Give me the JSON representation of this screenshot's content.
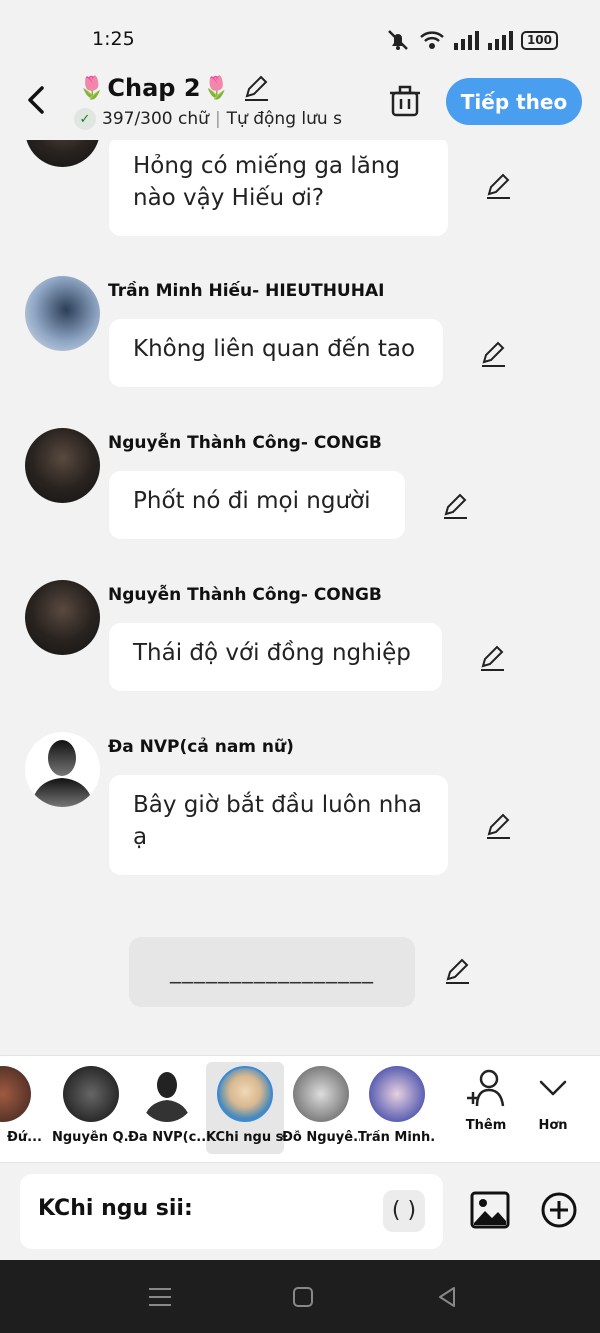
{
  "status": {
    "time": "1:25",
    "battery": "100"
  },
  "header": {
    "title": "Chap 2",
    "word_count": "397/300 chữ",
    "autosave": "Tự động lưu s",
    "next_button": "Tiếp theo"
  },
  "messages": [
    {
      "sender": "",
      "text": "Hỏng có miếng ga lăng nào vậy Hiếu ơi?"
    },
    {
      "sender": "Trần Minh Hiếu- HIEUTHUHAI",
      "text": "Không liên quan đến tao"
    },
    {
      "sender": "Nguyễn Thành Công- CONGB",
      "text": "Phốt nó đi mọi người"
    },
    {
      "sender": "Nguyễn Thành Công- CONGB",
      "text": "Thái độ với đồng nghiệp"
    },
    {
      "sender": "Đa NVP(cả nam nữ)",
      "text": "Bây giờ bắt đầu luôn nha ạ"
    }
  ],
  "empty_message": "_________________",
  "characters": [
    {
      "name": "Đứ..."
    },
    {
      "name": "Nguyễn Q..."
    },
    {
      "name": "Đa NVP(c..."
    },
    {
      "name": "KChi ngu sii"
    },
    {
      "name": "Đỗ Nguyê..."
    },
    {
      "name": "Trần Minh..."
    }
  ],
  "utilities": {
    "add": "Thêm",
    "more": "Hơn"
  },
  "input": {
    "current_speaker": "KChi ngu sii:",
    "paren": "( )"
  },
  "colors": {
    "accent": "#4a9ef0",
    "background": "#f2f2f2",
    "navbar": "#1e1e1e"
  }
}
